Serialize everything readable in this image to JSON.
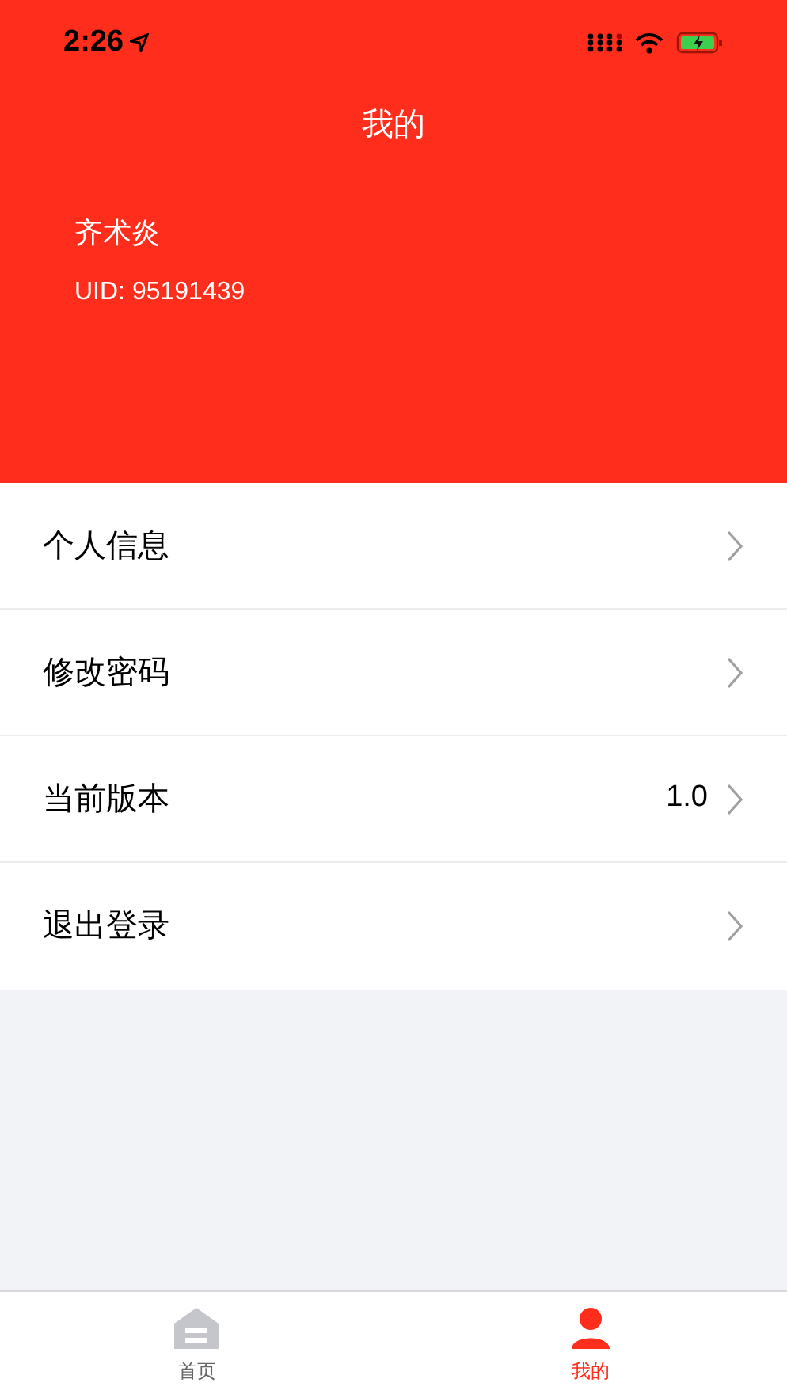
{
  "status_bar": {
    "time": "2:26"
  },
  "header": {
    "title": "我的",
    "name": "齐术炎",
    "uid": "UID: 95191439"
  },
  "menu": [
    {
      "label": "个人信息"
    },
    {
      "label": "修改密码"
    },
    {
      "label": "当前版本",
      "value": "1.0"
    },
    {
      "label": "退出登录"
    }
  ],
  "tab_bar": [
    {
      "label": "首页",
      "selected": false,
      "kind": "home"
    },
    {
      "label": "我的",
      "selected": true,
      "kind": "profile"
    }
  ]
}
